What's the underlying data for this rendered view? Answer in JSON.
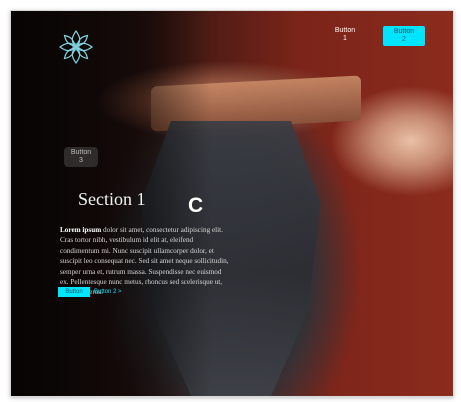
{
  "nav": {
    "button1": {
      "line1": "Button",
      "line2": "1"
    },
    "button2": {
      "line1": "Button",
      "line2": "2"
    }
  },
  "button3": {
    "line1": "Button",
    "line2": "3"
  },
  "section": {
    "title": "Section 1",
    "floating_letter": "C",
    "body_bold": "Lorem ipsum",
    "body_rest": " dolor sit amet, consectetur adipiscing elit. Cras tortor nibh, vestibulum id elit at, eleifend condimentum mi. Nunc suscipit ullamcorper dolor, et suscipit leo consequat nec. Sed sit amet neque sollicitudin, semper urna et, rutrum massa. Suspendisse nec euismod ex. Pellentesque nunc metus, rhoncus sed scelerisque ut, porta non eros."
  },
  "overlay": {
    "button_a": "Button",
    "button_b": "Button 2 >"
  },
  "colors": {
    "accent": "#00e5ff",
    "logo": "#7fd3df"
  }
}
